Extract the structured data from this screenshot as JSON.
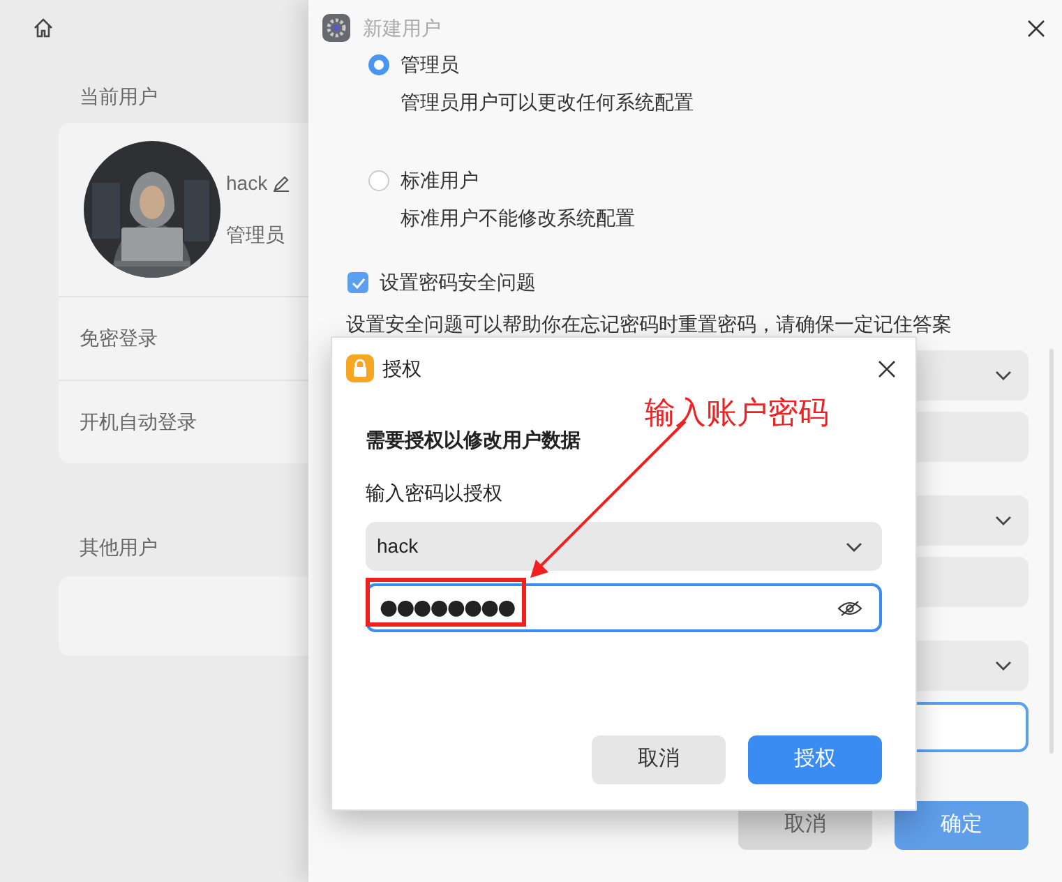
{
  "settings": {
    "current_user_heading": "当前用户",
    "user": {
      "name": "hack",
      "role": "管理员"
    },
    "options": [
      "免密登录",
      "开机自动登录"
    ],
    "other_users_heading": "其他用户"
  },
  "new_user_dialog": {
    "title": "新建用户",
    "account_types": [
      {
        "label": "管理员",
        "description": "管理员用户可以更改任何系统配置",
        "selected": true
      },
      {
        "label": "标准用户",
        "description": "标准用户不能修改系统配置",
        "selected": false
      }
    ],
    "security_question": {
      "label": "设置密码安全问题",
      "checked": true,
      "description": "设置安全问题可以帮助你在忘记密码时重置密码，请确保一定记住答案"
    },
    "fields": [
      {
        "kind": "dropdown",
        "focused": false
      },
      {
        "kind": "input",
        "focused": false
      },
      {
        "kind": "dropdown",
        "focused": false
      },
      {
        "kind": "input",
        "focused": false
      },
      {
        "kind": "dropdown",
        "focused": false
      },
      {
        "kind": "input",
        "focused": true
      }
    ],
    "buttons": [
      {
        "label": "取消",
        "kind": "secondary"
      },
      {
        "label": "确定",
        "kind": "primary"
      }
    ]
  },
  "auth_dialog": {
    "title": "授权",
    "heading": "需要授权以修改用户数据",
    "prompt": "输入密码以授权",
    "user": "hack",
    "password": "●●●●●●●●",
    "buttons": [
      {
        "label": "取消",
        "kind": "secondary"
      },
      {
        "label": "授权",
        "kind": "primary"
      }
    ]
  },
  "annotation": {
    "text": "输入账户密码"
  }
}
